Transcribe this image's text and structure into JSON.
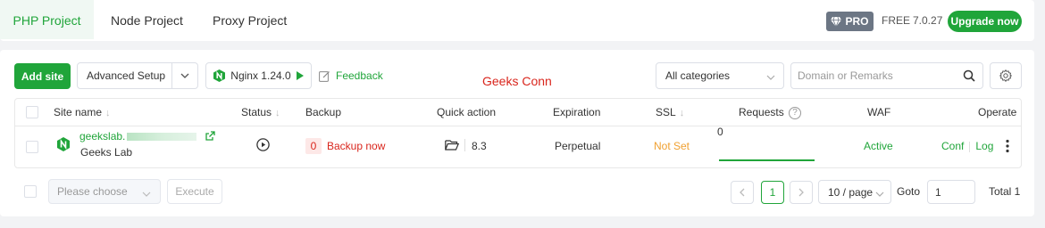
{
  "tabs": [
    {
      "label": "PHP Project",
      "active": true
    },
    {
      "label": "Node Project",
      "active": false
    },
    {
      "label": "Proxy Project",
      "active": false
    }
  ],
  "header": {
    "pro_label": "PRO",
    "free_label": "FREE",
    "version": "7.0.27",
    "upgrade_label": "Upgrade now"
  },
  "toolbar": {
    "add_site_label": "Add site",
    "advanced_setup_label": "Advanced Setup",
    "nginx_label": "Nginx 1.24.0",
    "feedback_label": "Feedback",
    "brand_text": "Geeks Conn",
    "category_value": "All categories",
    "search_placeholder": "Domain or Remarks"
  },
  "table": {
    "columns": {
      "site_name": "Site name",
      "status": "Status",
      "backup": "Backup",
      "quick_action": "Quick action",
      "expiration": "Expiration",
      "ssl": "SSL",
      "requests": "Requests",
      "waf": "WAF",
      "operate": "Operate"
    },
    "rows": [
      {
        "site_name": "geekslab.",
        "remark": "Geeks Lab",
        "backup_count": "0",
        "backup_label": "Backup now",
        "php_version": "8.3",
        "expiration": "Perpetual",
        "ssl": "Not Set",
        "requests": "0",
        "waf": "Active",
        "conf_label": "Conf",
        "log_label": "Log"
      }
    ]
  },
  "footer": {
    "batch_placeholder": "Please choose",
    "execute_label": "Execute",
    "current_page": "1",
    "per_page": "10 / page",
    "goto_label": "Goto",
    "goto_value": "1",
    "total_label": "Total 1"
  },
  "colors": {
    "accent": "#20a53a",
    "danger": "#d9251c",
    "warning": "#f0a030",
    "pro_badge": "#6c7684"
  }
}
